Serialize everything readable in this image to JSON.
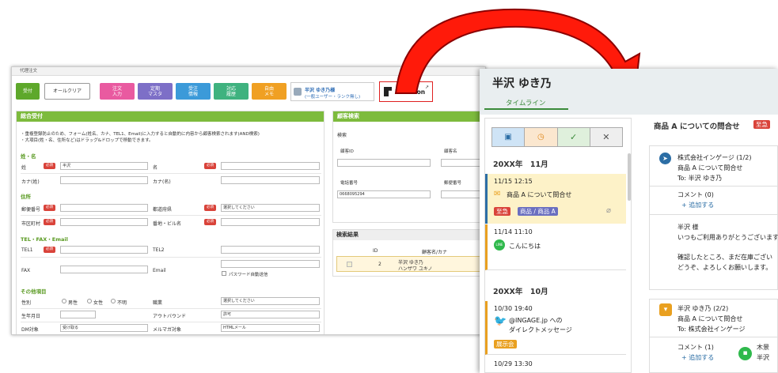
{
  "left": {
    "window_title": "代理注文",
    "toolbar": {
      "accept": "受付",
      "clear_all": "オールクリア",
      "order": "注文\n入力",
      "master": "定期\nマスタ",
      "receive": "受注\n情報",
      "history": "対応\n履歴",
      "memo": "自由\nメモ",
      "user_name": "半沢 ゆき乃様",
      "user_rank": "(一般ユーザー・ランク無し)",
      "relation": "Re:lation"
    },
    "form": {
      "title": "総合受付",
      "note1": "・重複登録防止のため、フォーム(姓名、カナ、TEL1、Email)に入力すると自動的に内容から顧客検索されます(AND検索)",
      "note2": "・大項目(姓・名、住所など)はドラッグ&ドロップで移動できます。",
      "sec_name": "姓・名",
      "sei": "姓",
      "sei_value": "半沢",
      "mei": "名",
      "kana_sei": "カナ(姓)",
      "kana_mei": "カナ(名)",
      "sec_addr": "住所",
      "zip": "郵便番号",
      "pref": "都道府県",
      "pref_value": "選択してください",
      "city": "市区町村",
      "street": "番地・ビル名",
      "sec_tel": "TEL・FAX・Email",
      "tel1": "TEL1",
      "tel2": "TEL2",
      "fax": "FAX",
      "email": "Email",
      "pw_auto": "パスワード自動送信",
      "sec_other": "その他項目",
      "gender": "性別",
      "male": "男性",
      "female": "女性",
      "unknown": "不明",
      "job": "職業",
      "job_value": "選択してください",
      "birthday": "生年月日",
      "outbound": "アウトバウンド",
      "outbound_value": "許可",
      "dm": "DM対象",
      "dm_value": "受け取る",
      "mail": "メルマガ対象",
      "mail_value": "HTMLメール",
      "required": "必須"
    },
    "search": {
      "title": "顧客検索",
      "subtitle": "検索",
      "customer_id": "顧客ID",
      "customer_name": "顧客名",
      "phone": "電話番号",
      "zip": "郵便番号",
      "phone_value": "0668095294"
    },
    "results": {
      "title": "検索結果",
      "col_id": "ID",
      "col_name": "顧客名/カナ",
      "row_id": "2",
      "row_name": "半沢 ゆき乃",
      "row_kana": "ハンザワ ユキノ"
    }
  },
  "right": {
    "name": "半沢 ゆき乃",
    "tab": "タイムライン",
    "m1": "20XX年　11月",
    "i1_time": "11/15 12:15",
    "i1_title": "商品 A について問合せ",
    "i1_tag1": "至急",
    "i1_tag2": "商品 / 商品 A",
    "i2_time": "11/14 11:10",
    "i2_title": "こんにちは",
    "m2": "20XX年　10月",
    "i3_time": "10/30 19:40",
    "i3_l1": "@INGAGE.jp への",
    "i3_l2": "ダイレクトメッセージ",
    "i3_tag": "展示会",
    "i4_time": "10/29 13:30",
    "detail_title": "商品 A についての問合せ",
    "detail_badge": "至急",
    "t1_from": "株式会社インゲージ (1/2)",
    "t1_subject": "商品 A について問合せ",
    "t1_to": "To: 半沢 ゆき乃",
    "comment": "コメント (0)",
    "add": "+ 追加する",
    "b_name": "半沢 様",
    "b_l1": "いつもご利用ありがとうございます",
    "b_l2": "確認したところ、まだ在庫ござい",
    "b_l3": "どうぞ、よろしくお願いします。",
    "t2_from": "半沢 ゆき乃 (2/2)",
    "t2_subject": "商品 A について問合せ",
    "t2_to": "To: 株式会社インゲージ",
    "comment2": "コメント (1)",
    "add2": "+ 追加する",
    "c_user": "木景",
    "c_text": "半沢"
  }
}
